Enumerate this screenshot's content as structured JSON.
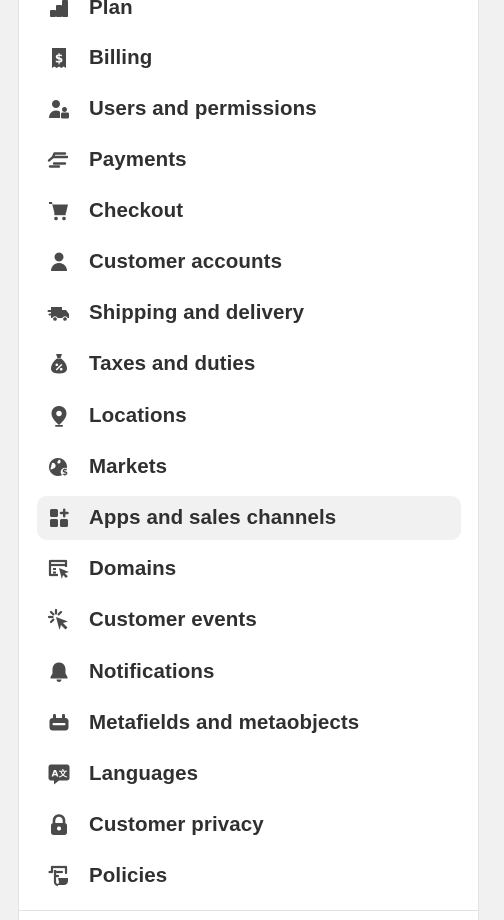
{
  "settings_nav": {
    "items": [
      {
        "label": "Plan",
        "icon": "plan-icon"
      },
      {
        "label": "Billing",
        "icon": "billing-icon"
      },
      {
        "label": "Users and permissions",
        "icon": "users-icon"
      },
      {
        "label": "Payments",
        "icon": "payments-icon"
      },
      {
        "label": "Checkout",
        "icon": "cart-icon"
      },
      {
        "label": "Customer accounts",
        "icon": "person-icon"
      },
      {
        "label": "Shipping and delivery",
        "icon": "truck-icon"
      },
      {
        "label": "Taxes and duties",
        "icon": "tax-bag-icon"
      },
      {
        "label": "Locations",
        "icon": "location-pin-icon"
      },
      {
        "label": "Markets",
        "icon": "globe-icon"
      },
      {
        "label": "Apps and sales channels",
        "icon": "apps-icon"
      },
      {
        "label": "Domains",
        "icon": "domains-icon"
      },
      {
        "label": "Customer events",
        "icon": "cursor-click-icon"
      },
      {
        "label": "Notifications",
        "icon": "bell-icon"
      },
      {
        "label": "Metafields and metaobjects",
        "icon": "metafields-icon"
      },
      {
        "label": "Languages",
        "icon": "language-icon"
      },
      {
        "label": "Customer privacy",
        "icon": "lock-icon"
      },
      {
        "label": "Policies",
        "icon": "policies-icon"
      }
    ],
    "active_item": "Apps and sales channels"
  },
  "colors": {
    "text": "#303030",
    "icon": "#4a4a4a",
    "active_background": "#f1f1f1",
    "page_background": "#f1f1f1",
    "panel_background": "#ffffff"
  }
}
